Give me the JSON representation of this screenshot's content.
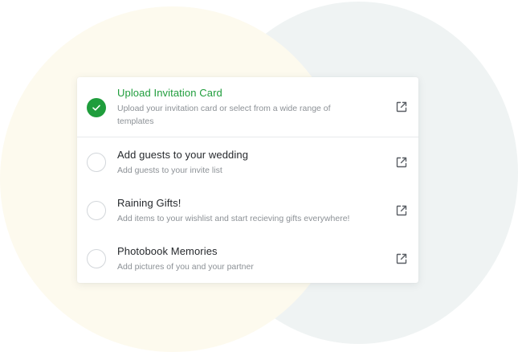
{
  "colors": {
    "accent_green": "#1f9d3c",
    "title_text": "#26292d",
    "description_text": "#8c9196",
    "background_blob_cream": "#fdfaee",
    "background_blob_teal": "#eff3f3"
  },
  "tasks": [
    {
      "title": "Upload Invitation Card",
      "description": "Upload your invitation card or select from a wide range of templates",
      "completed": true,
      "status_icon": "check-icon",
      "action_icon": "external-link-icon"
    },
    {
      "title": "Add guests to your wedding",
      "description": "Add guests to your invite list",
      "completed": false,
      "status_icon": "empty-circle",
      "action_icon": "external-link-icon"
    },
    {
      "title": "Raining Gifts!",
      "description": "Add items to your wishlist and start recieving gifts everywhere!",
      "completed": false,
      "status_icon": "empty-circle",
      "action_icon": "external-link-icon"
    },
    {
      "title": "Photobook Memories",
      "description": "Add pictures of you and your partner",
      "completed": false,
      "status_icon": "empty-circle",
      "action_icon": "external-link-icon"
    }
  ]
}
